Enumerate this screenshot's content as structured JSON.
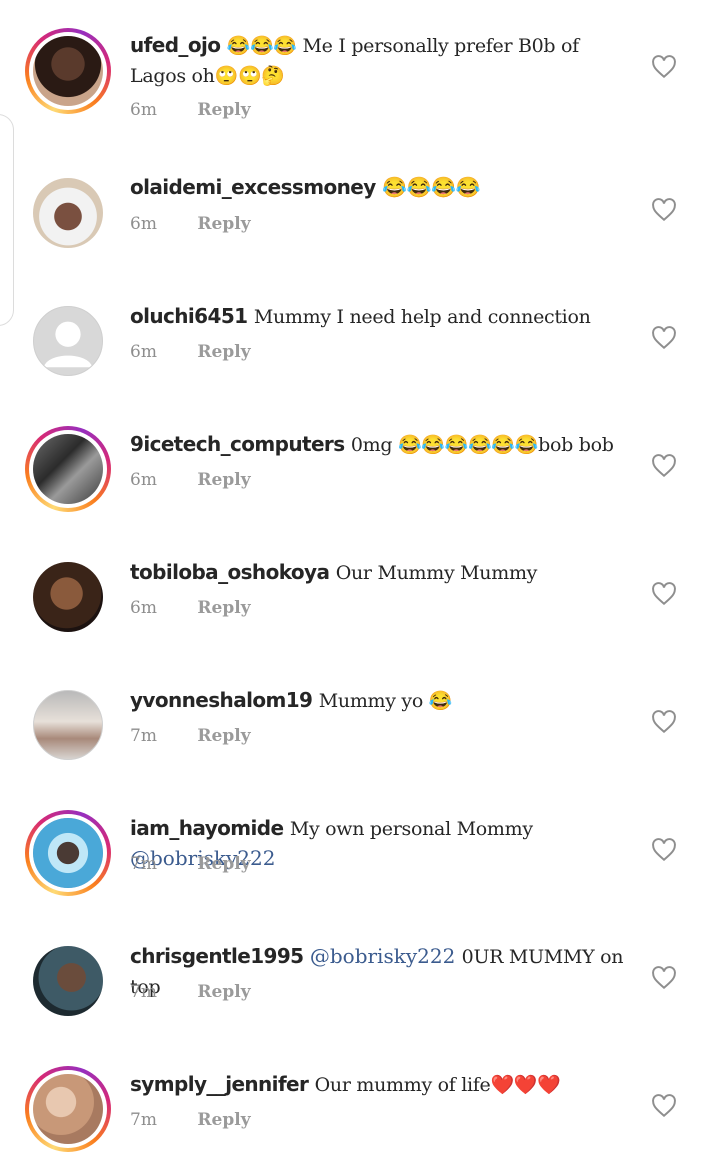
{
  "comments": [
    {
      "username": "ufed_ojo",
      "text": "😂😂😂 Me I personally prefer B0b of Lagos oh🙄🙄🤔",
      "time": "6m",
      "reply": "Reply"
    },
    {
      "username": "olaidemi_excessmoney",
      "text": "😂😂😂😂",
      "time": "6m",
      "reply": "Reply"
    },
    {
      "username": "oluchi6451",
      "text": "Mummy I need help and connection",
      "time": "6m",
      "reply": "Reply"
    },
    {
      "username": "9icetech_computers",
      "text": "0mg 😂😂😂😂😂😂bob bob",
      "time": "6m",
      "reply": "Reply"
    },
    {
      "username": "tobiloba_oshokoya",
      "text": "Our  Mummy Mummy",
      "time": "6m",
      "reply": "Reply"
    },
    {
      "username": "yvonneshalom19",
      "text": "Mummy yo 😂",
      "time": "7m",
      "reply": "Reply"
    },
    {
      "username": "iam_hayomide",
      "text": "My own personal Mommy",
      "mention": "@bobrisky222",
      "time": "7m",
      "reply": "Reply"
    },
    {
      "username": "chrisgentle1995",
      "mention": "@bobrisky222",
      "text": " 0UR MUMMY on top",
      "time": "7m",
      "reply": "Reply"
    },
    {
      "username": "symply__jennifer",
      "text": "Our mummy of life❤️❤️❤️",
      "time": "7m",
      "reply": "Reply"
    }
  ],
  "colors": {
    "mention": "#3b5b8e",
    "meta": "#8e8e8e",
    "text": "#262626"
  },
  "icons": {
    "like": "heart-outline-icon"
  }
}
